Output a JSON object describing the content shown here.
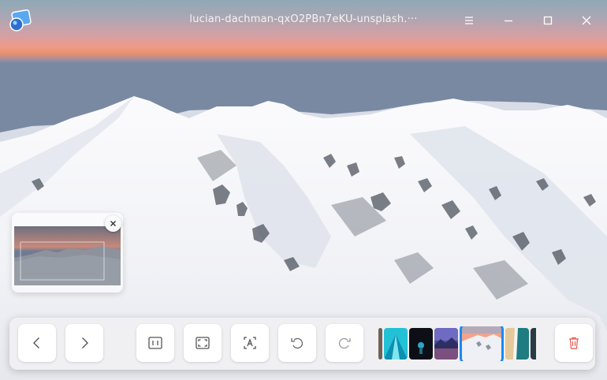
{
  "window": {
    "title": "lucian-dachman-qxO2PBn7eKU-unsplash.···",
    "icons": [
      "image-viewer-app-icon",
      "menu-icon",
      "minimize-icon",
      "maximize-icon",
      "close-icon"
    ]
  },
  "viewer": {
    "image_description_icon": "snowy-mountain-photo"
  },
  "navigator": {
    "close_icon": "close-icon"
  },
  "toolbar": {
    "buttons": [
      {
        "name": "previous-button",
        "icon": "chevron-left-icon"
      },
      {
        "name": "next-button",
        "icon": "chevron-right-icon"
      },
      {
        "name": "original-size-button",
        "icon": "actual-size-icon"
      },
      {
        "name": "fit-window-button",
        "icon": "fit-window-icon"
      },
      {
        "name": "ocr-button",
        "icon": "text-recognition-icon"
      },
      {
        "name": "rotate-left-button",
        "icon": "rotate-counterclockwise-icon"
      },
      {
        "name": "rotate-right-button",
        "icon": "rotate-clockwise-icon"
      },
      {
        "name": "delete-button",
        "icon": "trash-icon"
      }
    ],
    "thumbnails": [
      "partial-thumbnail",
      "cyan-mountain",
      "dark-figure",
      "purple-lake",
      "snowy-mountain (active)",
      "beach-aerial",
      "dark-partial"
    ]
  },
  "colors": {
    "accent": "#1e88f0",
    "delete": "#e8584e",
    "toolbar_bg": "#f0f0f2"
  }
}
